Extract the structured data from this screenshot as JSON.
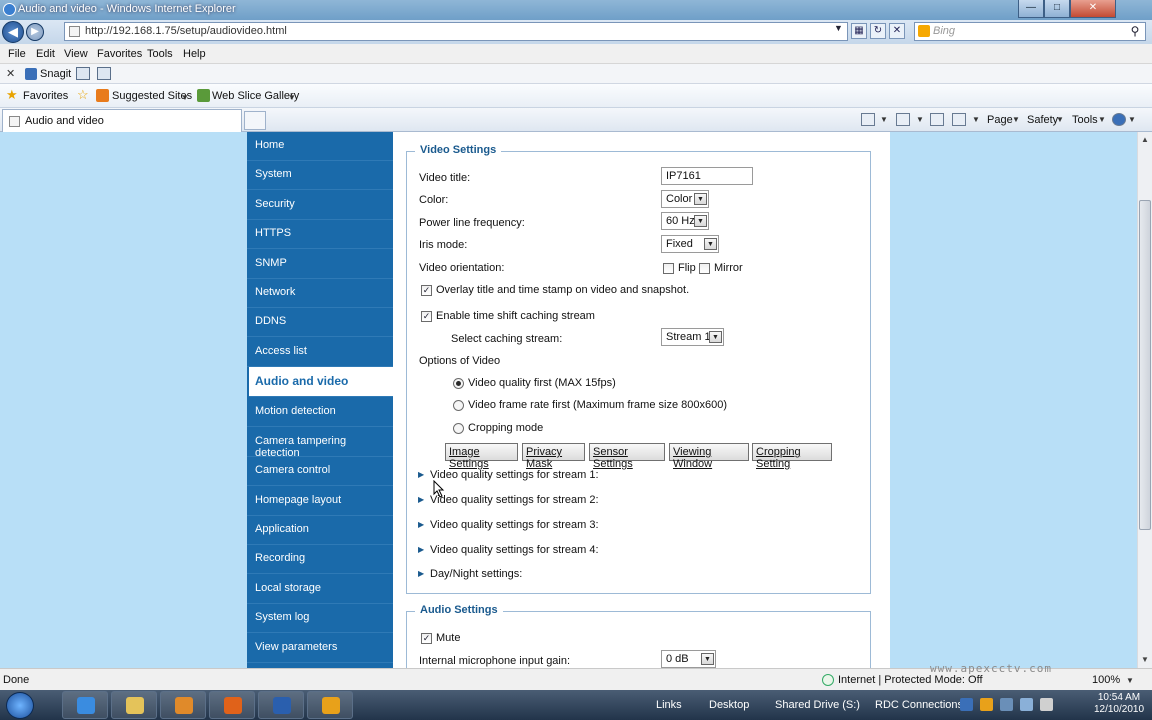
{
  "window": {
    "title": "Audio and video - Windows Internet Explorer"
  },
  "address": {
    "url": "http://192.168.1.75/setup/audiovideo.html",
    "search_placeholder": "Bing"
  },
  "menubar": [
    "File",
    "Edit",
    "View",
    "Favorites",
    "Tools",
    "Help"
  ],
  "snagit": {
    "label": "Snagit"
  },
  "favorites": {
    "label": "Favorites",
    "suggested": "Suggested Sites",
    "webslice": "Web Slice Gallery"
  },
  "tab": {
    "title": "Audio and video"
  },
  "command": {
    "page": "Page",
    "safety": "Safety",
    "tools": "Tools"
  },
  "nav": [
    "Home",
    "System",
    "Security",
    "HTTPS",
    "SNMP",
    "Network",
    "DDNS",
    "Access list",
    "Audio and video",
    "Motion detection",
    "Camera tampering detection",
    "Camera control",
    "Homepage layout",
    "Application",
    "Recording",
    "Local storage",
    "System log",
    "View parameters"
  ],
  "video": {
    "legend": "Video Settings",
    "title_label": "Video title:",
    "title_value": "IP7161",
    "color_label": "Color:",
    "color_value": "Color",
    "power_label": "Power line frequency:",
    "power_value": "60 Hz",
    "iris_label": "Iris mode:",
    "iris_value": "Fixed",
    "orientation_label": "Video orientation:",
    "flip_label": "Flip",
    "mirror_label": "Mirror",
    "overlay_label": "Overlay title and time stamp on video and snapshot.",
    "timeshift_label": "Enable time shift caching stream",
    "caching_label": "Select caching stream:",
    "caching_value": "Stream 1",
    "options_label": "Options of Video",
    "radio_quality": "Video quality first (MAX 15fps)",
    "radio_framerate": "Video frame rate first (Maximum frame size 800x600)",
    "radio_crop": "Cropping mode",
    "buttons": [
      "Image Settings",
      "Privacy Mask",
      "Sensor Settings",
      "Viewing Window",
      "Cropping Setting"
    ],
    "streams": [
      "Video quality settings for stream 1:",
      "Video quality settings for stream 2:",
      "Video quality settings for stream 3:",
      "Video quality settings for stream 4:",
      "Day/Night settings:"
    ]
  },
  "audio": {
    "legend": "Audio Settings",
    "mute_label": "Mute",
    "gain_label": "Internal microphone input gain:",
    "gain_value": "0 dB"
  },
  "status": {
    "text": "Done",
    "zone": "Internet | Protected Mode: Off",
    "zoom": "100%",
    "watermark": "www.apexcctv.com"
  },
  "taskbar": {
    "links": "Links",
    "desktop": "Desktop",
    "shared": "Shared Drive (S:)",
    "rdc": "RDC Connections",
    "time": "10:54 AM",
    "date": "12/10/2010"
  }
}
